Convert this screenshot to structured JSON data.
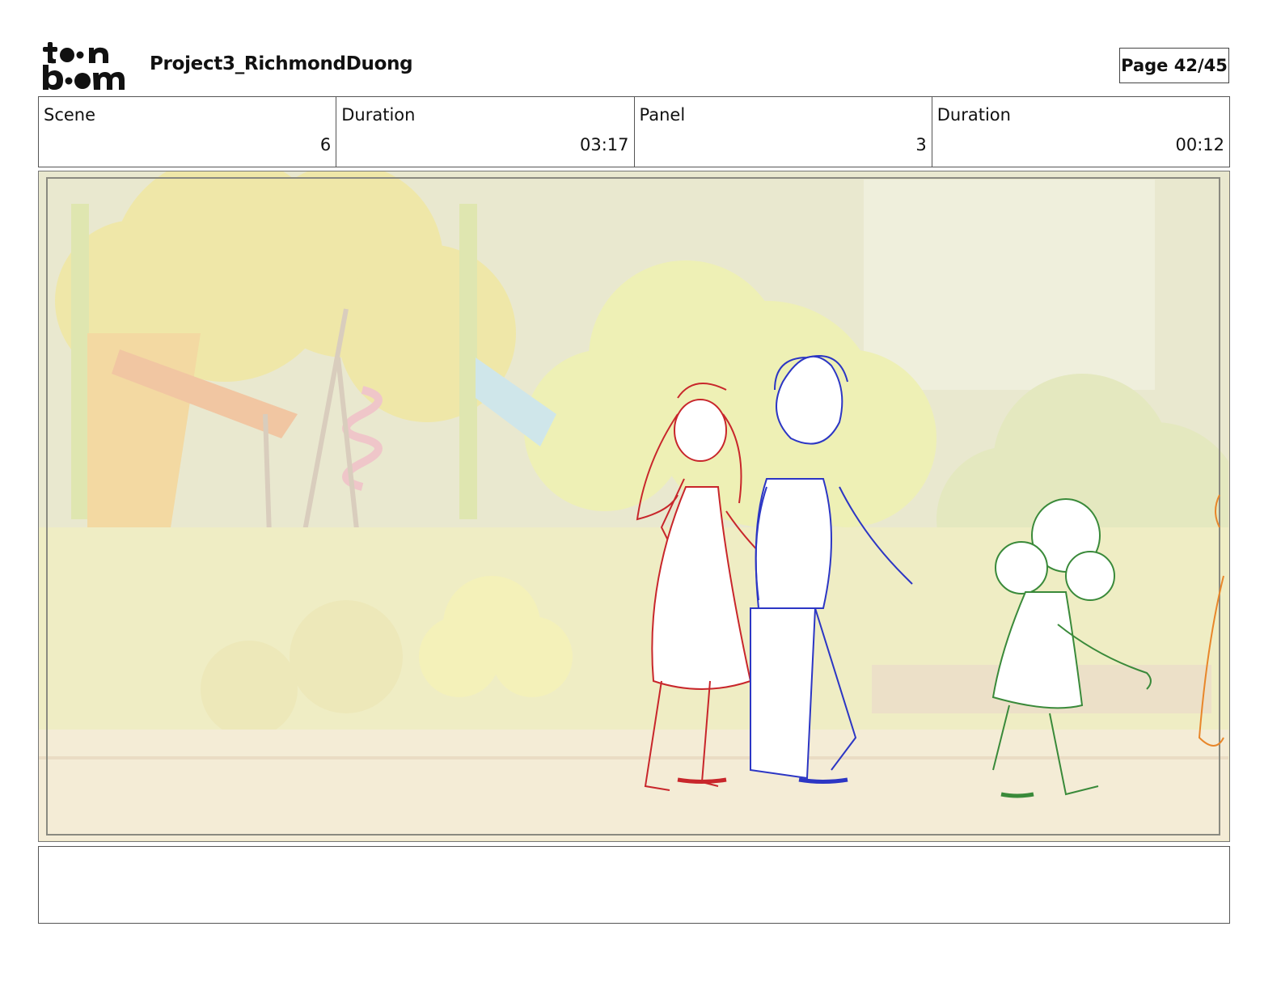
{
  "header": {
    "logo_text": "toonboom",
    "project_title": "Project3_RichmondDuong",
    "page_label": "Page 42/45"
  },
  "info": {
    "scene_label": "Scene",
    "scene_value": "6",
    "scene_duration_label": "Duration",
    "scene_duration_value": "03:17",
    "panel_label": "Panel",
    "panel_value": "3",
    "panel_duration_label": "Duration",
    "panel_duration_value": "00:12"
  },
  "notes": {
    "text": ""
  },
  "colors": {
    "girl_sketch": "#c8262b",
    "boy_sketch": "#2c36c4",
    "child_sketch": "#3a8a3a",
    "extra_sketch": "#e8862a"
  }
}
